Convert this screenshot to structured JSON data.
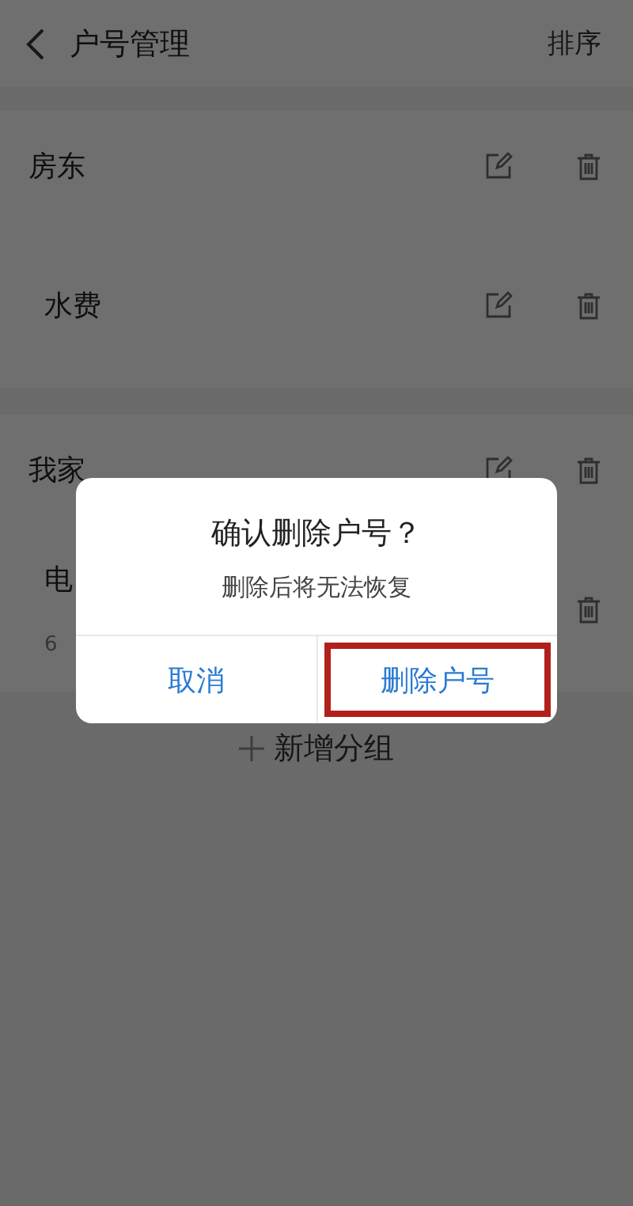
{
  "header": {
    "title": "户号管理",
    "action": "排序"
  },
  "groups": [
    {
      "name": "房东",
      "accounts": [
        {
          "name": "水费"
        }
      ]
    },
    {
      "name": "我家",
      "accounts": [
        {
          "name": "电",
          "number": "6"
        }
      ]
    }
  ],
  "add_group": {
    "label": "新增分组"
  },
  "dialog": {
    "title": "确认删除户号？",
    "message": "删除后将无法恢复",
    "buttons": [
      {
        "label": "取消",
        "highlighted": false
      },
      {
        "label": "删除户号",
        "highlighted": true
      }
    ]
  }
}
